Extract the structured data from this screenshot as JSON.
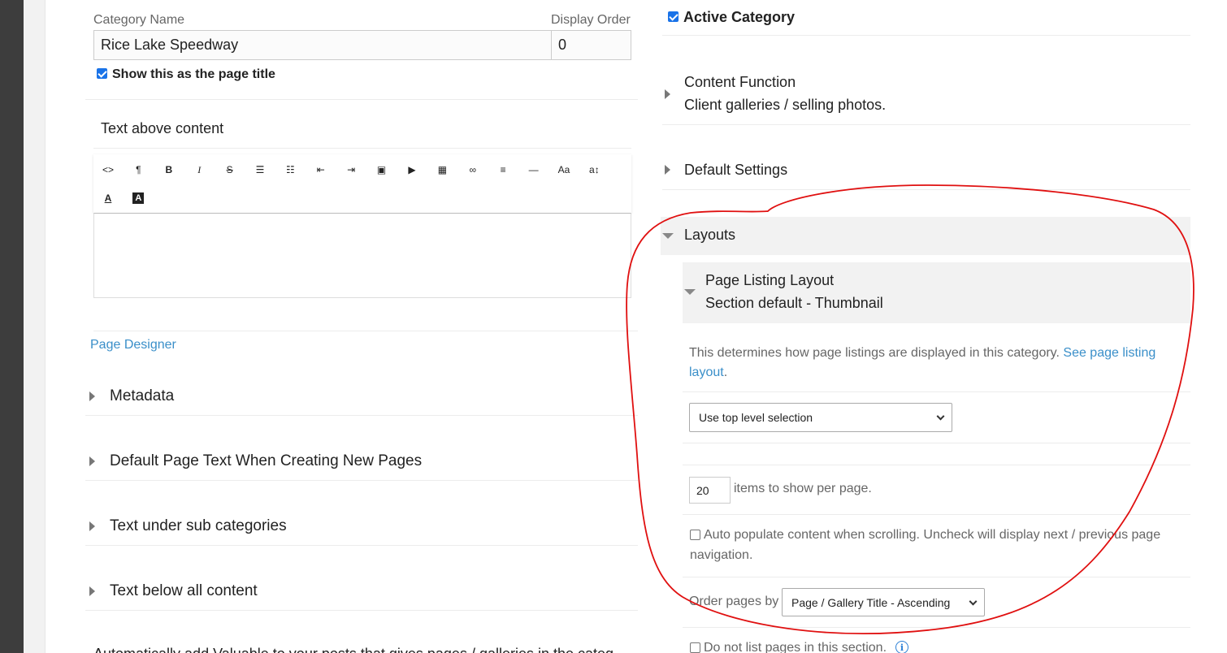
{
  "category": {
    "name_label": "Category Name",
    "name_value": "Rice Lake Speedway",
    "order_label": "Display Order",
    "order_value": "0",
    "show_title_label": "Show this as the page title",
    "active_label": "Active Category"
  },
  "text_above": {
    "heading": "Text above content",
    "toolbar_icons": [
      "code-view-icon",
      "paragraph-icon",
      "bold-icon",
      "italic-icon",
      "strikethrough-icon",
      "bullet-list-icon",
      "numbered-list-icon",
      "outdent-icon",
      "indent-icon",
      "image-icon",
      "video-icon",
      "table-icon",
      "link-icon",
      "align-icon",
      "horizontal-rule-icon",
      "font-size-icon",
      "line-height-icon",
      "font-color-icon",
      "background-color-icon"
    ],
    "toolbar_glyphs": [
      "<>",
      "¶",
      "B",
      "I",
      "S",
      "☰",
      "☷",
      "⇤",
      "⇥",
      "▣",
      "▶",
      "▦",
      "∞",
      "≡",
      "—",
      "Aa",
      "a↕",
      "A",
      "A"
    ]
  },
  "left_links": {
    "page_designer": "Page Designer"
  },
  "left_sections": [
    "Metadata",
    "Default Page Text When Creating New Pages",
    "Text under sub categories",
    "Text below all content"
  ],
  "left_bottom_text": "Automatically add Valuable to your posts that gives pages / galleries in the category",
  "right_sections": {
    "content_function": {
      "title": "Content Function",
      "value": "Client galleries / selling photos."
    },
    "default_settings": {
      "title": "Default Settings"
    },
    "layouts": {
      "title": "Layouts"
    }
  },
  "page_listing": {
    "title": "Page Listing Layout",
    "value": "Section default - Thumbnail",
    "description": "This determines how page listings are displayed in this category.",
    "description_link_part1": "See page listing",
    "description_link_part2": "layout",
    "description_end": ".",
    "layout_select": "Use top level selection",
    "items_value": "20",
    "items_label": "items to show per page.",
    "auto_populate_part1": "Auto populate content when scrolling. Uncheck will display next / previous page",
    "auto_populate_part2": "navigation.",
    "order_label": "Order pages by",
    "order_select": "Page / Gallery Title - Ascending",
    "do_not_list": "Do not list pages in this section."
  },
  "colors": {
    "accent": "#1a73e8",
    "link": "#3a8fc9",
    "annotation": "#e01010",
    "sidebar": "#3d3d3d"
  }
}
